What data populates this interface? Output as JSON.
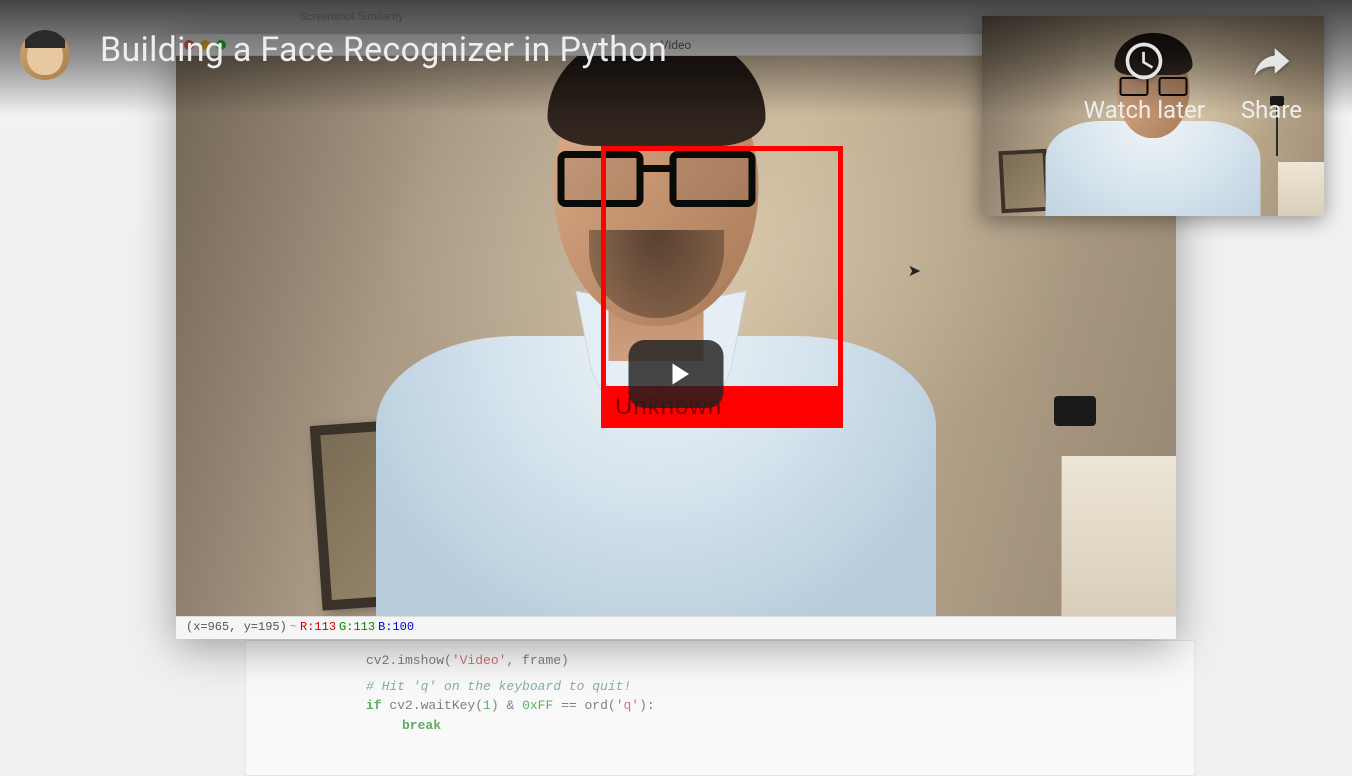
{
  "video": {
    "title": "Building a Face Recognizer in Python",
    "actions": {
      "watch_later": "Watch later",
      "share": "Share"
    }
  },
  "window": {
    "title": "Video"
  },
  "detection": {
    "label": "Unknown",
    "box_color": "#ff0000"
  },
  "statusbar": {
    "coords": "(x=965, y=195)",
    "separator": " ~ ",
    "r": "R:113",
    "g": "G:113",
    "b": "B:100"
  },
  "notebook": {
    "line1a": "cv2.imshow(",
    "line1b": "'Video'",
    "line1c": ", frame)",
    "line2": "# Hit 'q' on the keyboard to quit!",
    "line3a": "if",
    "line3b": " cv2.waitKey(",
    "line3c": "1",
    "line3d": ") & ",
    "line3e": "0xFF",
    "line3f": " == ord(",
    "line3g": "'q'",
    "line3h": "):",
    "line4": "break"
  },
  "bg": {
    "tab_hint": "Screenshot Similarity"
  }
}
